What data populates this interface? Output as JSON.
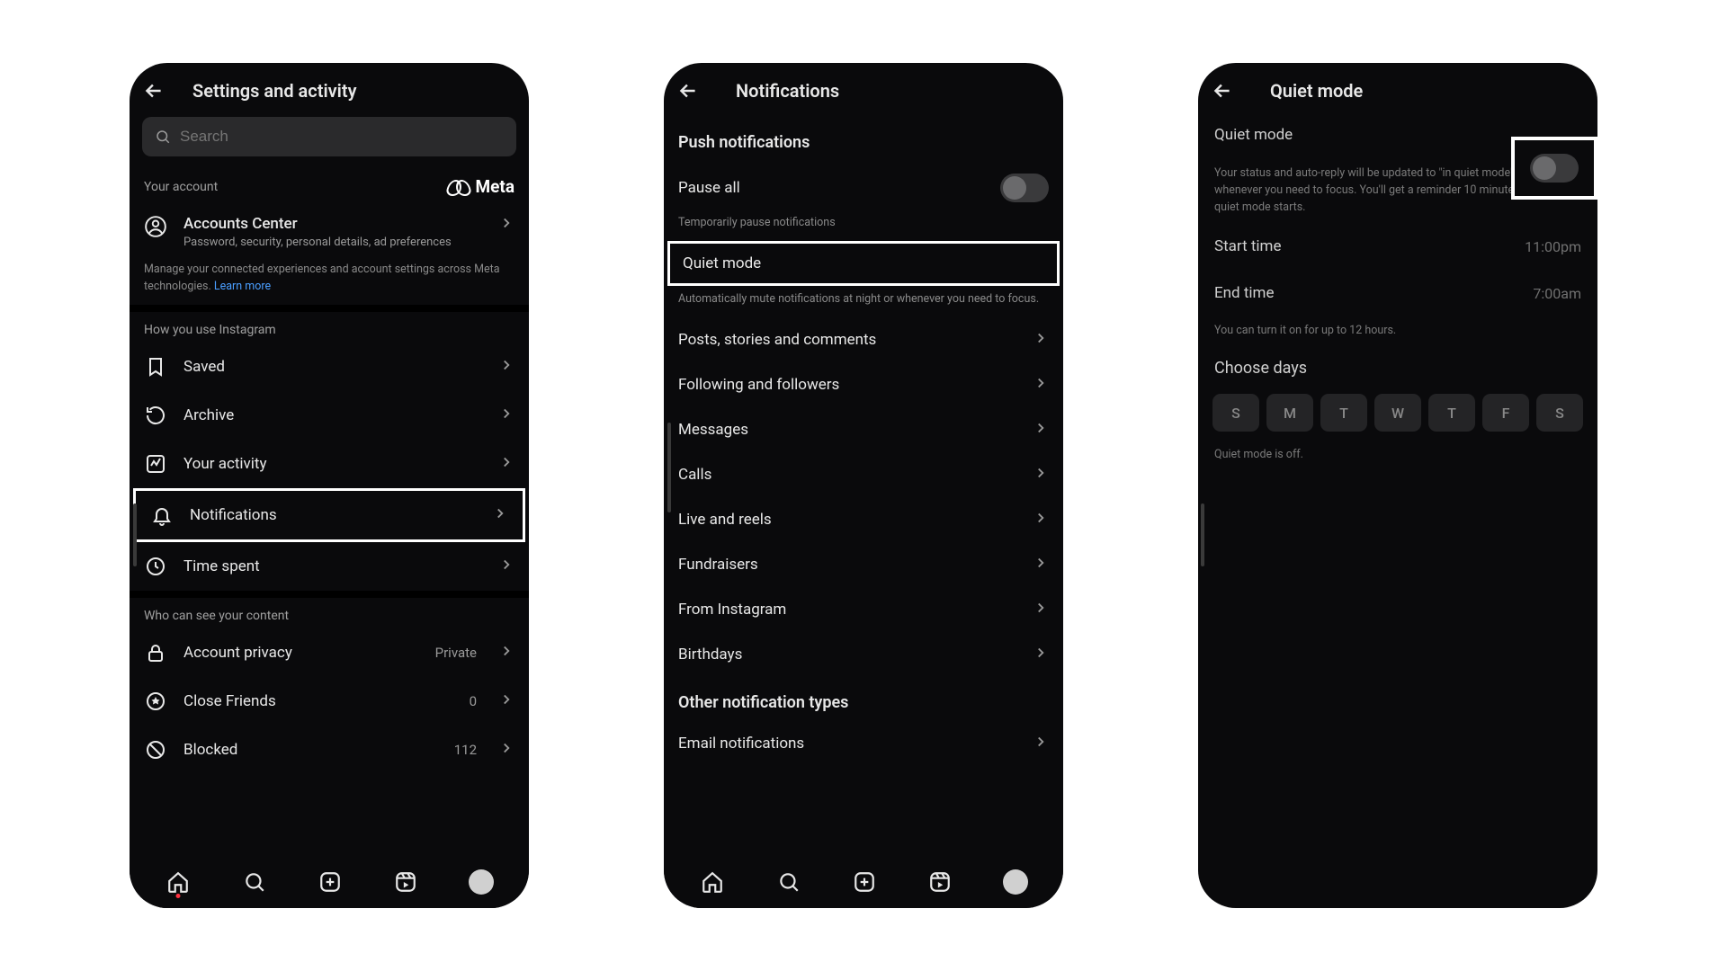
{
  "phone1": {
    "title": "Settings and activity",
    "search_placeholder": "Search",
    "your_account_label": "Your account",
    "meta_label": "Meta",
    "accounts_center": {
      "title": "Accounts Center",
      "subtitle": "Password, security, personal details, ad preferences"
    },
    "manage_text": "Manage your connected experiences and account settings across Meta technologies. ",
    "learn_more": "Learn more",
    "section_usage": "How you use Instagram",
    "items_usage": [
      {
        "label": "Saved"
      },
      {
        "label": "Archive"
      },
      {
        "label": "Your activity"
      },
      {
        "label": "Notifications"
      },
      {
        "label": "Time spent"
      }
    ],
    "section_privacy": "Who can see your content",
    "items_privacy": [
      {
        "label": "Account privacy",
        "value": "Private"
      },
      {
        "label": "Close Friends",
        "value": "0"
      },
      {
        "label": "Blocked",
        "value": "112"
      }
    ]
  },
  "phone2": {
    "title": "Notifications",
    "push_section": "Push notifications",
    "pause_all": "Pause all",
    "pause_sub": "Temporarily pause notifications",
    "quiet_mode": "Quiet mode",
    "quiet_sub": "Automatically mute notifications at night or whenever you need to focus.",
    "categories": [
      "Posts, stories and comments",
      "Following and followers",
      "Messages",
      "Calls",
      "Live and reels",
      "Fundraisers",
      "From Instagram",
      "Birthdays"
    ],
    "other_section": "Other notification types",
    "email": "Email notifications"
  },
  "phone3": {
    "title": "Quiet mode",
    "quiet_mode_label": "Quiet mode",
    "description": "Your status and auto-reply will be updated to \"in quiet mode\" at night or whenever you need to focus. You'll get a reminder 10 minutes before quiet mode starts.",
    "start_label": "Start time",
    "start_value": "11:00pm",
    "end_label": "End time",
    "end_value": "7:00am",
    "duration_note": "You can turn it on for up to 12 hours.",
    "choose_days": "Choose days",
    "days": [
      "S",
      "M",
      "T",
      "W",
      "T",
      "F",
      "S"
    ],
    "off_note": "Quiet mode is off."
  }
}
